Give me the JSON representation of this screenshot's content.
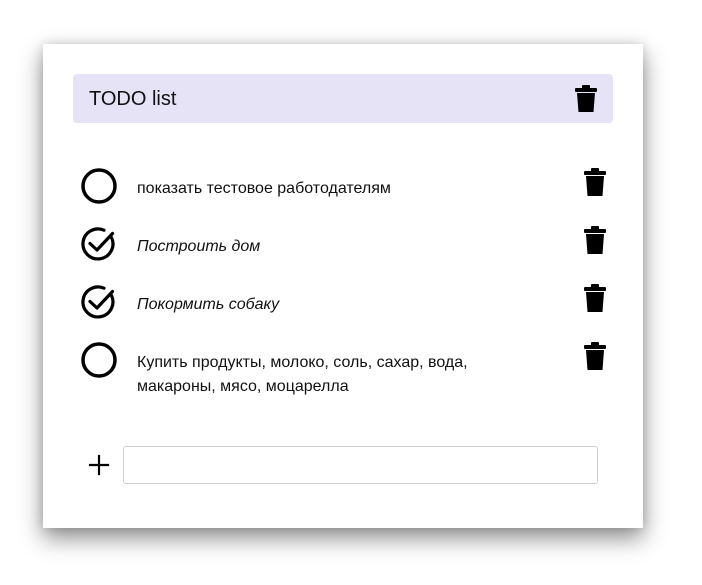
{
  "header": {
    "title": "TODO list",
    "bg_color": "#e6e3f7"
  },
  "items": [
    {
      "text": "показать тестовое работодателям",
      "done": false
    },
    {
      "text": "Построить дом",
      "done": true
    },
    {
      "text": "Покормить собаку",
      "done": true
    },
    {
      "text": "Купить продукты, молоко, соль, сахар, вода, макароны, мясо, моцарелла",
      "done": false
    }
  ],
  "icons": {
    "delete": "trash-icon",
    "todo": "empty-circle-icon",
    "done": "check-circle-icon",
    "add": "plus-icon"
  },
  "new_item": {
    "value": "",
    "placeholder": ""
  }
}
